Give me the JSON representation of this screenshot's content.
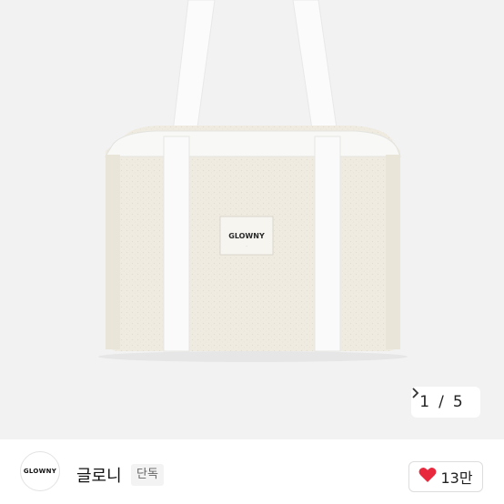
{
  "product": {
    "image_alt": "GLOWNY canvas tote bag",
    "label_text": "GLOWNY",
    "pager": {
      "current": "1",
      "separator": "/",
      "total": "5",
      "next_icon": "chevron-right-icon"
    }
  },
  "seller": {
    "avatar_text": "GLOWNY",
    "name": "글로니",
    "badge": "단독"
  },
  "like": {
    "icon": "heart-icon",
    "icon_color": "#e8283c",
    "count": "13만"
  }
}
